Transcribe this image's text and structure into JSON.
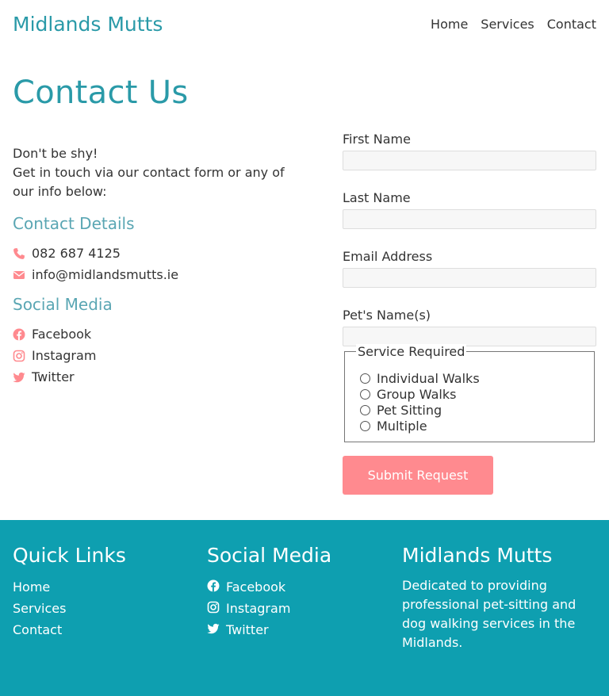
{
  "header": {
    "brand": "Midlands Mutts",
    "nav": [
      "Home",
      "Services",
      "Contact"
    ]
  },
  "main": {
    "title": "Contact Us",
    "intro_line1": "Don't be shy!",
    "intro_line2": "Get in touch via our contact form or any of our info below:",
    "contact_heading": "Contact Details",
    "phone": "082 687 4125",
    "email": "info@midlandsmutts.ie",
    "social_heading": "Social Media",
    "social": [
      "Facebook",
      "Instagram",
      "Twitter"
    ]
  },
  "form": {
    "first_name_label": "First Name",
    "first_name_value": "",
    "last_name_label": "Last Name",
    "last_name_value": "",
    "email_label": "Email Address",
    "email_value": "",
    "pet_label": "Pet's Name(s)",
    "pet_value": "",
    "service_legend": "Service Required",
    "services": [
      "Individual Walks",
      "Group Walks",
      "Pet Sitting",
      "Multiple"
    ],
    "submit_label": "Submit Request"
  },
  "footer": {
    "quick_links_heading": "Quick Links",
    "quick_links": [
      "Home",
      "Services",
      "Contact"
    ],
    "social_heading": "Social Media",
    "social": [
      "Facebook",
      "Instagram",
      "Twitter"
    ],
    "about_heading": "Midlands Mutts",
    "about_text": "Dedicated to providing professional pet-sitting and dog walking services in the Midlands."
  },
  "colors": {
    "brand_teal": "#2a9aa8",
    "accent_pink": "#ff8a8f",
    "footer_bg": "#0e9fb0"
  },
  "icons": {
    "phone": "phone-icon",
    "email": "envelope-icon",
    "facebook": "facebook-icon",
    "instagram": "instagram-icon",
    "twitter": "twitter-icon"
  }
}
